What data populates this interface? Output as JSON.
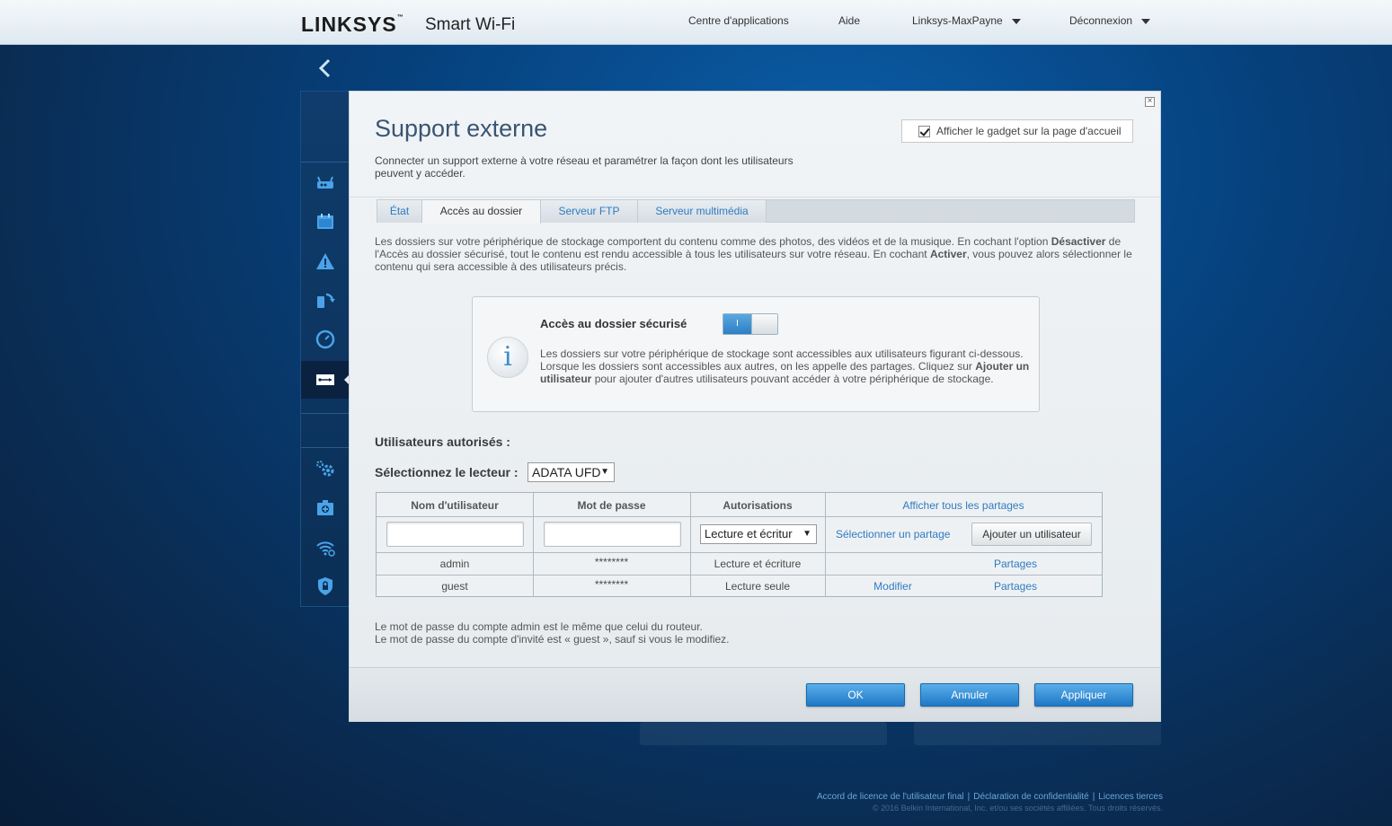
{
  "header": {
    "logo": "LINKSYS",
    "logo_tm": "™",
    "logo_sub": "Smart Wi-Fi",
    "nav": {
      "app_center": "Centre d'applications",
      "help": "Aide",
      "router": "Linksys-MaxPayne",
      "logout": "Déconnexion"
    }
  },
  "sidebar": {
    "icons": [
      "router-icon",
      "calendar-icon",
      "warning-icon",
      "devices-icon",
      "speed-icon",
      "usb-icon",
      "settings-icon",
      "media-icon",
      "wifi-icon",
      "security-icon"
    ],
    "active": "usb-icon"
  },
  "modal": {
    "title": "Support externe",
    "subtitle": "Connecter un support externe à votre réseau et paramétrer la façon dont les utilisateurs peuvent y accéder.",
    "gadget_label": "Afficher le gadget sur la page d'accueil",
    "tabs": [
      "État",
      "Accès au dossier",
      "Serveur FTP",
      "Serveur multimédia"
    ],
    "active_tab": "Accès au dossier",
    "description": {
      "part1": "Les dossiers sur votre périphérique de stockage comportent du contenu comme des photos, des vidéos et de la musique. En cochant l'option ",
      "bold1": "Désactiver",
      "part2": " de l'Accès au dossier sécurisé, tout le contenu est rendu accessible à tous les utilisateurs sur votre réseau. En cochant ",
      "bold2": "Activer",
      "part3": ", vous pouvez alors sélectionner le contenu qui sera accessible à des utilisateurs précis."
    },
    "info": {
      "icon_glyph": "i",
      "title": "Accès au dossier sécurisé",
      "toggle_label": "I",
      "text_part1": "Les dossiers sur votre périphérique de stockage sont accessibles aux utilisateurs figurant ci-dessous. Lorsque les dossiers sont accessibles aux autres, on les appelle des partages. Cliquez sur ",
      "text_bold": "Ajouter un utilisateur",
      "text_part2": " pour ajouter d'autres utilisateurs pouvant accéder à votre périphérique de stockage."
    },
    "authorized_label": "Utilisateurs autorisés :",
    "drive_label": "Sélectionnez le lecteur :",
    "drive_value": "ADATA UFD",
    "select_arrow": "▼",
    "table": {
      "headers": [
        "Nom d'utilisateur",
        "Mot de passe",
        "Autorisations"
      ],
      "show_all_shares": "Afficher tous les partages",
      "new_row": {
        "username_value": "",
        "password_value": "",
        "permission": "Lecture et écritur",
        "select_share": "Sélectionner un partage",
        "add_user": "Ajouter un utilisateur"
      },
      "rows": [
        {
          "user": "admin",
          "password": "********",
          "perm": "Lecture et écriture",
          "modify": "",
          "shares": "Partages"
        },
        {
          "user": "guest",
          "password": "********",
          "perm": "Lecture seule",
          "modify": "Modifier",
          "shares": "Partages"
        }
      ]
    },
    "footnote_1": "Le mot de passe du compte admin est le même que celui du routeur.",
    "footnote_2": "Le mot de passe du compte d'invité est « guest », sauf si vous le modifiez.",
    "buttons": {
      "ok": "OK",
      "cancel": "Annuler",
      "apply": "Appliquer"
    },
    "close": "×"
  },
  "footer": {
    "eula": "Accord de licence de l'utilisateur final",
    "privacy": "Déclaration de confidentialité",
    "third_party": "Licences tierces",
    "separator": "|",
    "copyright": "© 2016 Belkin International, Inc. et/ou ses sociétés affiliées. Tous droits réservés."
  },
  "colors": {
    "accent": "#2f7bc1",
    "button_blue": "#1f78c6",
    "title": "#3a5573"
  }
}
